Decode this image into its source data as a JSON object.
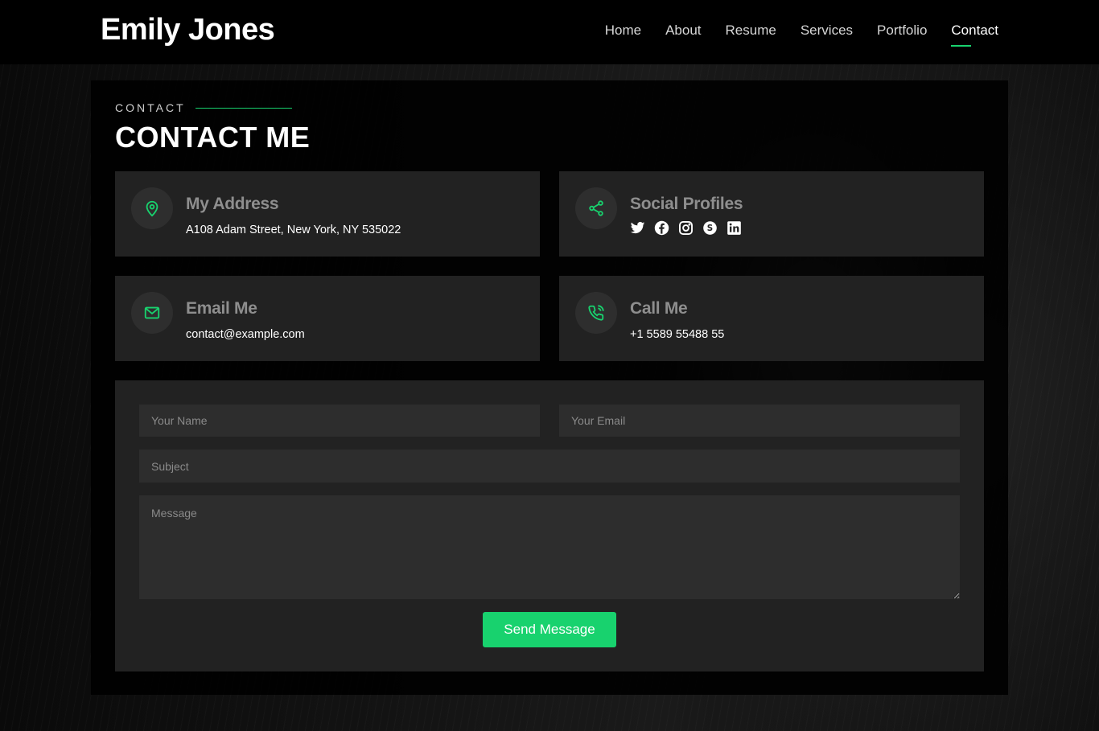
{
  "brand": {
    "name": "Emily Jones",
    "accent_color": "#18d26e"
  },
  "nav": {
    "items": [
      {
        "label": "Home",
        "active": false
      },
      {
        "label": "About",
        "active": false
      },
      {
        "label": "Resume",
        "active": false
      },
      {
        "label": "Services",
        "active": false
      },
      {
        "label": "Portfolio",
        "active": false
      },
      {
        "label": "Contact",
        "active": true
      }
    ]
  },
  "section": {
    "eyebrow": "CONTACT",
    "title": "CONTACT ME"
  },
  "cards": {
    "address": {
      "icon": "map-pin-icon",
      "title": "My Address",
      "value": "A108 Adam Street, New York, NY 535022"
    },
    "social": {
      "icon": "share-icon",
      "title": "Social Profiles",
      "links": [
        "twitter-icon",
        "facebook-icon",
        "instagram-icon",
        "skype-icon",
        "linkedin-icon"
      ]
    },
    "email": {
      "icon": "envelope-icon",
      "title": "Email Me",
      "value": "contact@example.com"
    },
    "phone": {
      "icon": "phone-icon",
      "title": "Call Me",
      "value": "+1 5589 55488 55"
    }
  },
  "form": {
    "name_placeholder": "Your Name",
    "email_placeholder": "Your Email",
    "subject_placeholder": "Subject",
    "message_placeholder": "Message",
    "submit_label": "Send Message"
  }
}
